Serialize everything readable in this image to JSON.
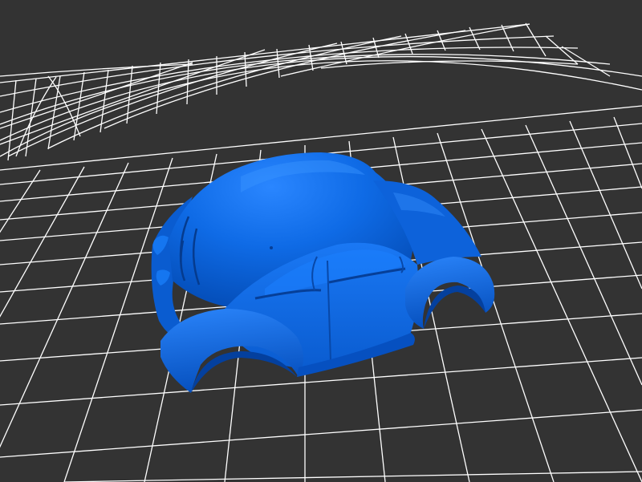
{
  "viewer": {
    "background_color": "#333333",
    "grid_color": "#ffffff",
    "model_color": "#0a64d8",
    "model": "car-body-shell"
  }
}
